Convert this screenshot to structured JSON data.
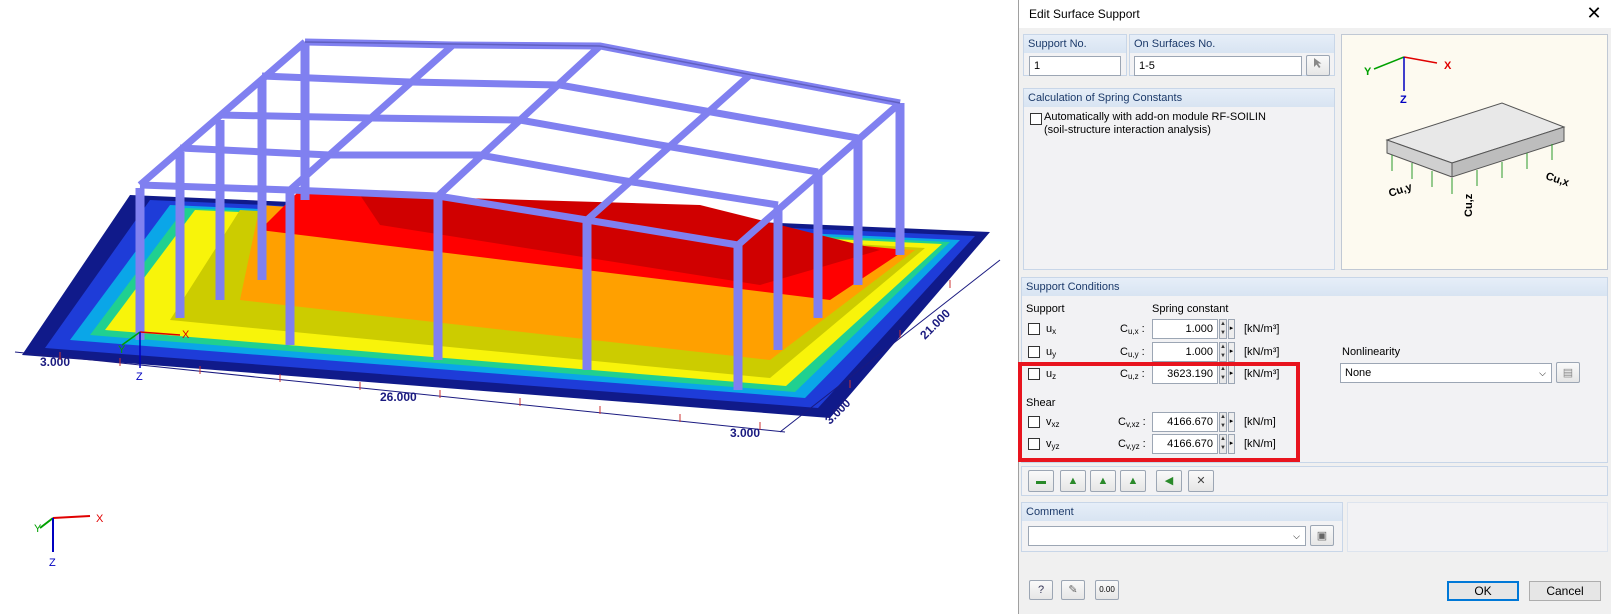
{
  "viewport": {
    "dimensions": {
      "d1": "3.000",
      "d2": "26.000",
      "d3": "3.000",
      "d4": "21.000",
      "d5": "3.000"
    },
    "axes": {
      "x": "X",
      "y": "Y",
      "z": "Z"
    },
    "model_axes": {
      "x": "X",
      "y": "Y",
      "z": "Z"
    },
    "colors": {
      "frame": "#8080f0",
      "plate_blue": "#101a8a",
      "hot": "#e00000",
      "orange": "#ffa000",
      "yellow": "#ffff00"
    }
  },
  "dialog": {
    "title": "Edit Surface Support",
    "close_icon": "close-icon",
    "support_no": {
      "label": "Support No.",
      "value": "1"
    },
    "on_surfaces": {
      "label": "On Surfaces No.",
      "value": "1-5"
    },
    "calc": {
      "header": "Calculation of Spring Constants",
      "checkbox_line1": "Automatically with add-on module RF-SOILIN",
      "checkbox_line2": "(soil-structure interaction analysis)"
    },
    "figure": {
      "x": "X",
      "y": "Y",
      "z": "Z",
      "cux": "Cu,x",
      "cuy": "Cu,y",
      "cuz": "Cu,z"
    },
    "conditions": {
      "header": "Support Conditions",
      "support_label": "Support",
      "spring_label": "Spring constant",
      "shear_label": "Shear",
      "nonlinearity_label": "Nonlinearity",
      "nonlinearity_value": "None",
      "rows": [
        {
          "check": "u",
          "sub": "x",
          "const": "C",
          "csub": "u,x",
          "value": "1.000",
          "unit": "[kN/m³]"
        },
        {
          "check": "u",
          "sub": "y",
          "const": "C",
          "csub": "u,y",
          "value": "1.000",
          "unit": "[kN/m³]"
        },
        {
          "check": "u",
          "sub": "z",
          "const": "C",
          "csub": "u,z",
          "value": "3623.190",
          "unit": "[kN/m³]"
        },
        {
          "check": "v",
          "sub": "xz",
          "const": "C",
          "csub": "v,xz",
          "value": "4166.670",
          "unit": "[kN/m]"
        },
        {
          "check": "v",
          "sub": "yz",
          "const": "C",
          "csub": "v,yz",
          "value": "4166.670",
          "unit": "[kN/m]"
        }
      ]
    },
    "comment": {
      "label": "Comment",
      "value": ""
    },
    "bottom": {
      "ok": "OK",
      "cancel": "Cancel",
      "num_icon_text": "0.00"
    },
    "highlight_color": "#e8141e"
  }
}
